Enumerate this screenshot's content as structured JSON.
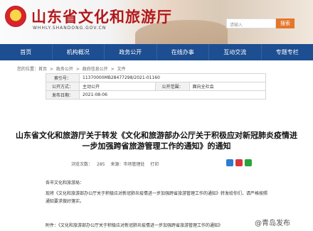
{
  "header": {
    "site_title": "山东省文化和旅游厅",
    "site_url": "WHHLY.SHANDONG.GOV.CN",
    "search_placeholder": "请输入",
    "search_button": "搜索"
  },
  "nav": {
    "items": [
      "首页",
      "机构概况",
      "政务公开",
      "在线办事",
      "互动交流",
      "专题专栏"
    ]
  },
  "breadcrumb": {
    "items": [
      "您的位置：首页",
      ">",
      "政务公开",
      ">",
      "政府信息公开",
      ">",
      "文件"
    ]
  },
  "info": {
    "index_label": "索引号：",
    "index_value": "11370000MB28477298/2021-01160",
    "disclosure_label": "公开方式：",
    "disclosure_value": "主动公开",
    "scope_label": "公开范围：",
    "scope_value": "面向全社会",
    "date_label": "发布日期：",
    "date_value": "2021-08-06"
  },
  "article": {
    "title_line1": "山东省文化和旅游厅关于转发《文化和旅游部办公厅关于积极应对新冠肺炎疫情进",
    "title_line2": "一步加强跨省旅游管理工作的通知》的通知",
    "views_label": "浏览次数：",
    "views_value": "285",
    "source": "来源：市场管理处",
    "print": "打印",
    "greeting": "各市文化和旅游局：",
    "para1": "现将《文化和旅游部办公厅关于积极应对新冠肺炎疫情进一步加强跨省旅游管理工作的通知》转发给你们，请严格按照通知要求做好落实。",
    "attachment": "附件：《文化和旅游部办公厅关于积极应对新冠肺炎疫情进一步加强跨省旅游管理工作的通知》"
  },
  "watermark": "@青岛发布",
  "colors": {
    "nav_bg": "#1c4e91",
    "title_red": "#b3181b",
    "search_btn": "#e5762b"
  }
}
